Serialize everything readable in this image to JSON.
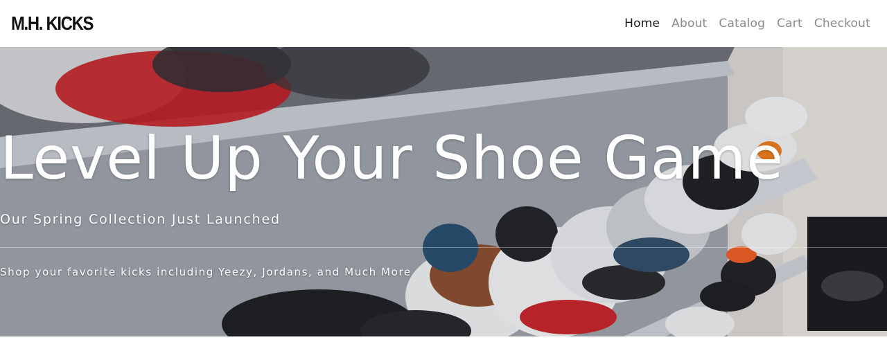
{
  "header": {
    "logo": "M.H. KICKS",
    "nav": [
      {
        "label": "Home",
        "active": true
      },
      {
        "label": "About",
        "active": false
      },
      {
        "label": "Catalog",
        "active": false
      },
      {
        "label": "Cart",
        "active": false
      },
      {
        "label": "Checkout",
        "active": false
      }
    ]
  },
  "hero": {
    "title": "Level Up Your Shoe Game",
    "subtitle": "Our Spring Collection Just Launched",
    "blurb": "Shop your favorite kicks including Yeezy, Jordans, and Much More",
    "image": "sneaker-shelf-photo"
  },
  "colors": {
    "nav_active": "#1a1a1a",
    "nav_inactive": "#8a8a8a",
    "hero_text": "#ffffff"
  }
}
